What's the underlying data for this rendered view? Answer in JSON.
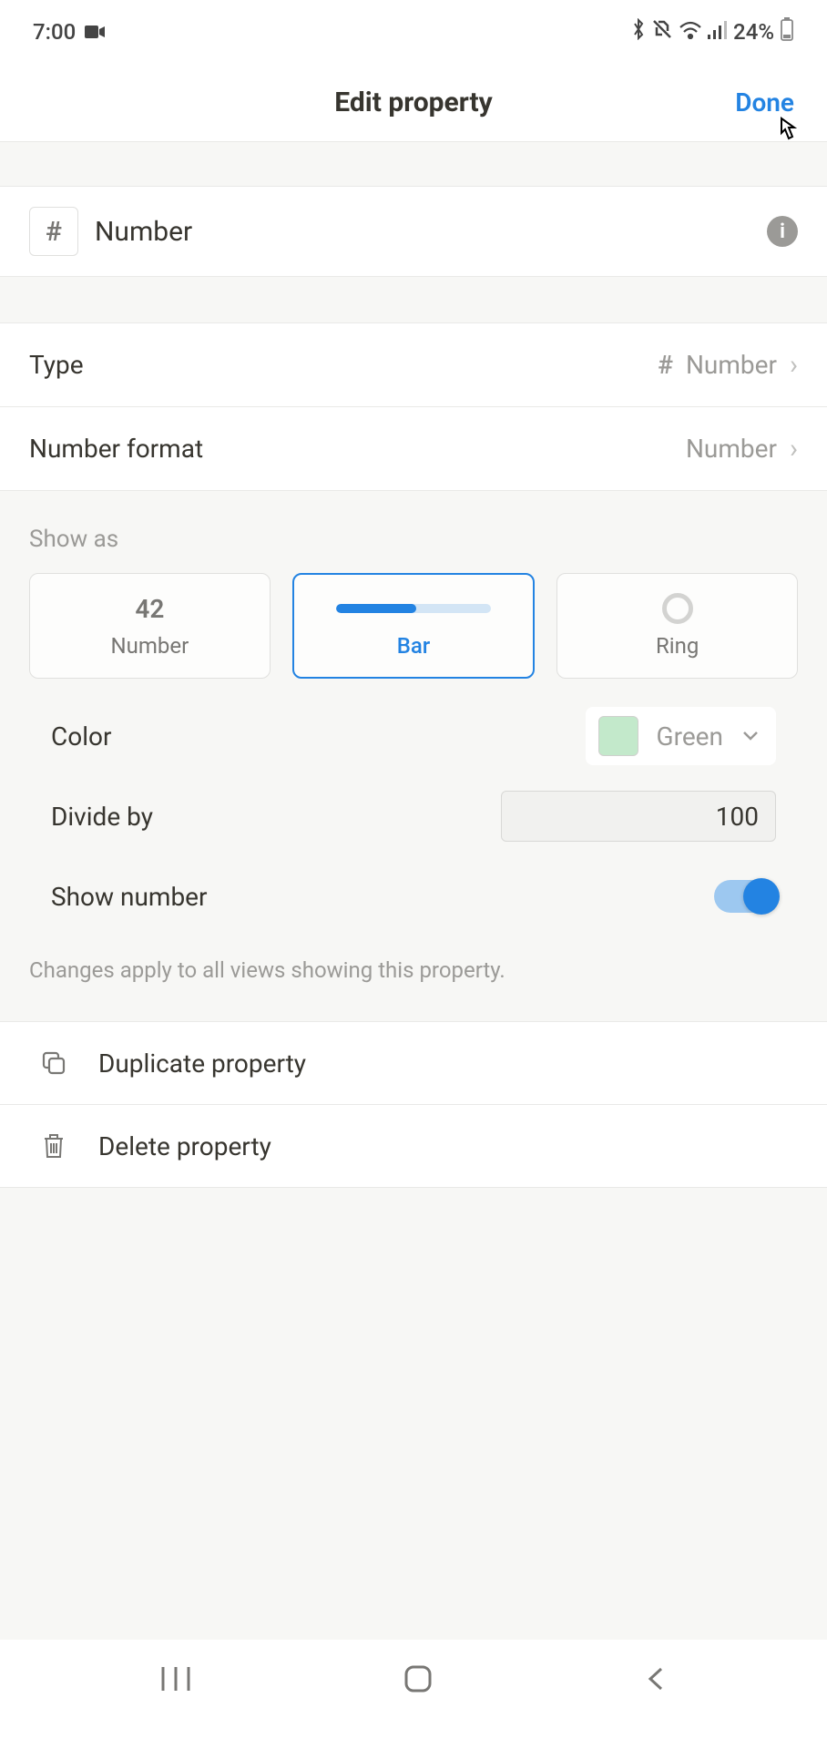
{
  "status": {
    "time": "7:00",
    "battery": "24%"
  },
  "header": {
    "title": "Edit property",
    "done": "Done"
  },
  "property": {
    "name": "Number"
  },
  "rows": {
    "type_label": "Type",
    "type_value": "Number",
    "format_label": "Number format",
    "format_value": "Number"
  },
  "show_as": {
    "label": "Show as",
    "number_preview": "42",
    "options": {
      "number": "Number",
      "bar": "Bar",
      "ring": "Ring"
    }
  },
  "settings": {
    "color_label": "Color",
    "color_value": "Green",
    "divide_label": "Divide by",
    "divide_value": "100",
    "show_number_label": "Show number"
  },
  "note": "Changes apply to all views showing this property.",
  "actions": {
    "duplicate": "Duplicate property",
    "delete": "Delete property"
  }
}
